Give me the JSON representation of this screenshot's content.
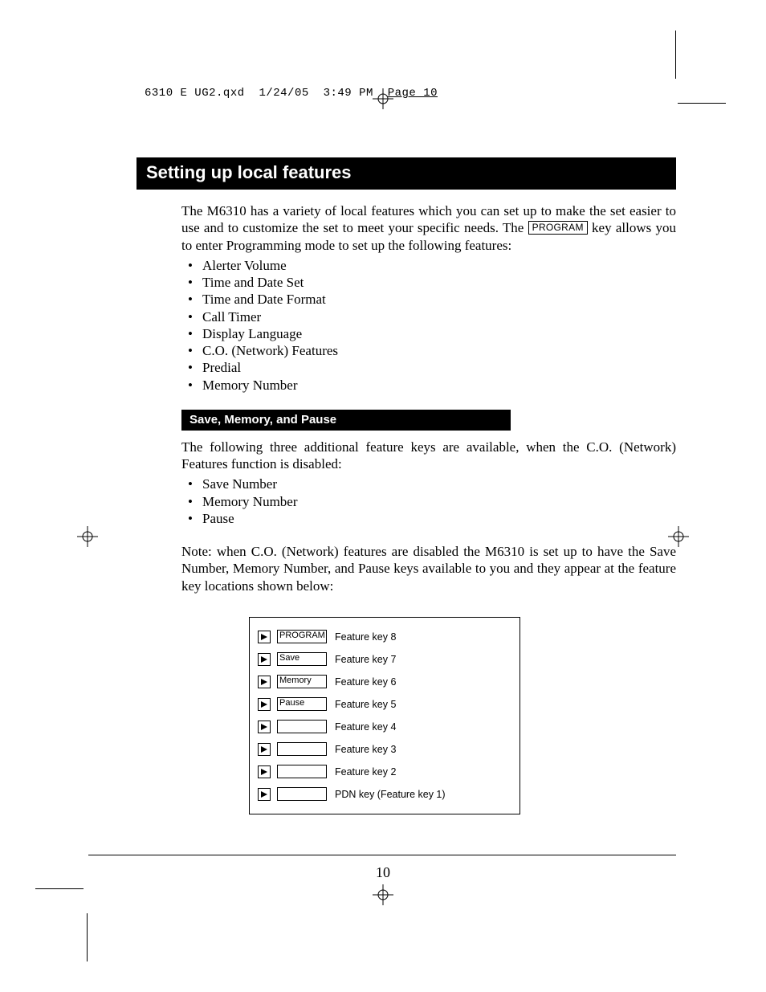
{
  "slug": {
    "file": "6310 E UG2.qxd",
    "date": "1/24/05",
    "time": "3:49 PM",
    "pagelabel": "Page 10"
  },
  "section_title": "Setting up local features",
  "intro_pre": "The M6310 has a variety of local features which you can set up to make the set easier to use and to customize the set to meet your specific needs. The ",
  "program_key": "PROGRAM",
  "intro_post": " key allows you to enter Programming mode to set up the following features:",
  "features": [
    "Alerter Volume",
    "Time and Date Set",
    "Time and Date Format",
    "Call Timer",
    "Display Language",
    "C.O. (Network) Features",
    "Predial",
    "Memory Number"
  ],
  "subheading": "Save, Memory, and Pause",
  "sub_paragraph": "The following three additional feature keys are available, when the C.O. (Network) Features function is disabled:",
  "sub_features": [
    "Save Number",
    "Memory Number",
    "Pause"
  ],
  "note": "Note: when C.O. (Network) features are disabled the M6310 is set up to have the Save Number, Memory Number, and Pause keys available to you and they appear at the feature key locations shown below:",
  "diagram_rows": [
    {
      "button": "PROGRAM",
      "label": "Feature key 8"
    },
    {
      "button": "Save",
      "label": "Feature key 7"
    },
    {
      "button": "Memory",
      "label": "Feature key 6"
    },
    {
      "button": "Pause",
      "label": "Feature key 5"
    },
    {
      "button": "",
      "label": "Feature key 4"
    },
    {
      "button": "",
      "label": "Feature key 3"
    },
    {
      "button": "",
      "label": "Feature key 2"
    },
    {
      "button": "",
      "label": "PDN key (Feature key 1)"
    }
  ],
  "page_number": "10"
}
